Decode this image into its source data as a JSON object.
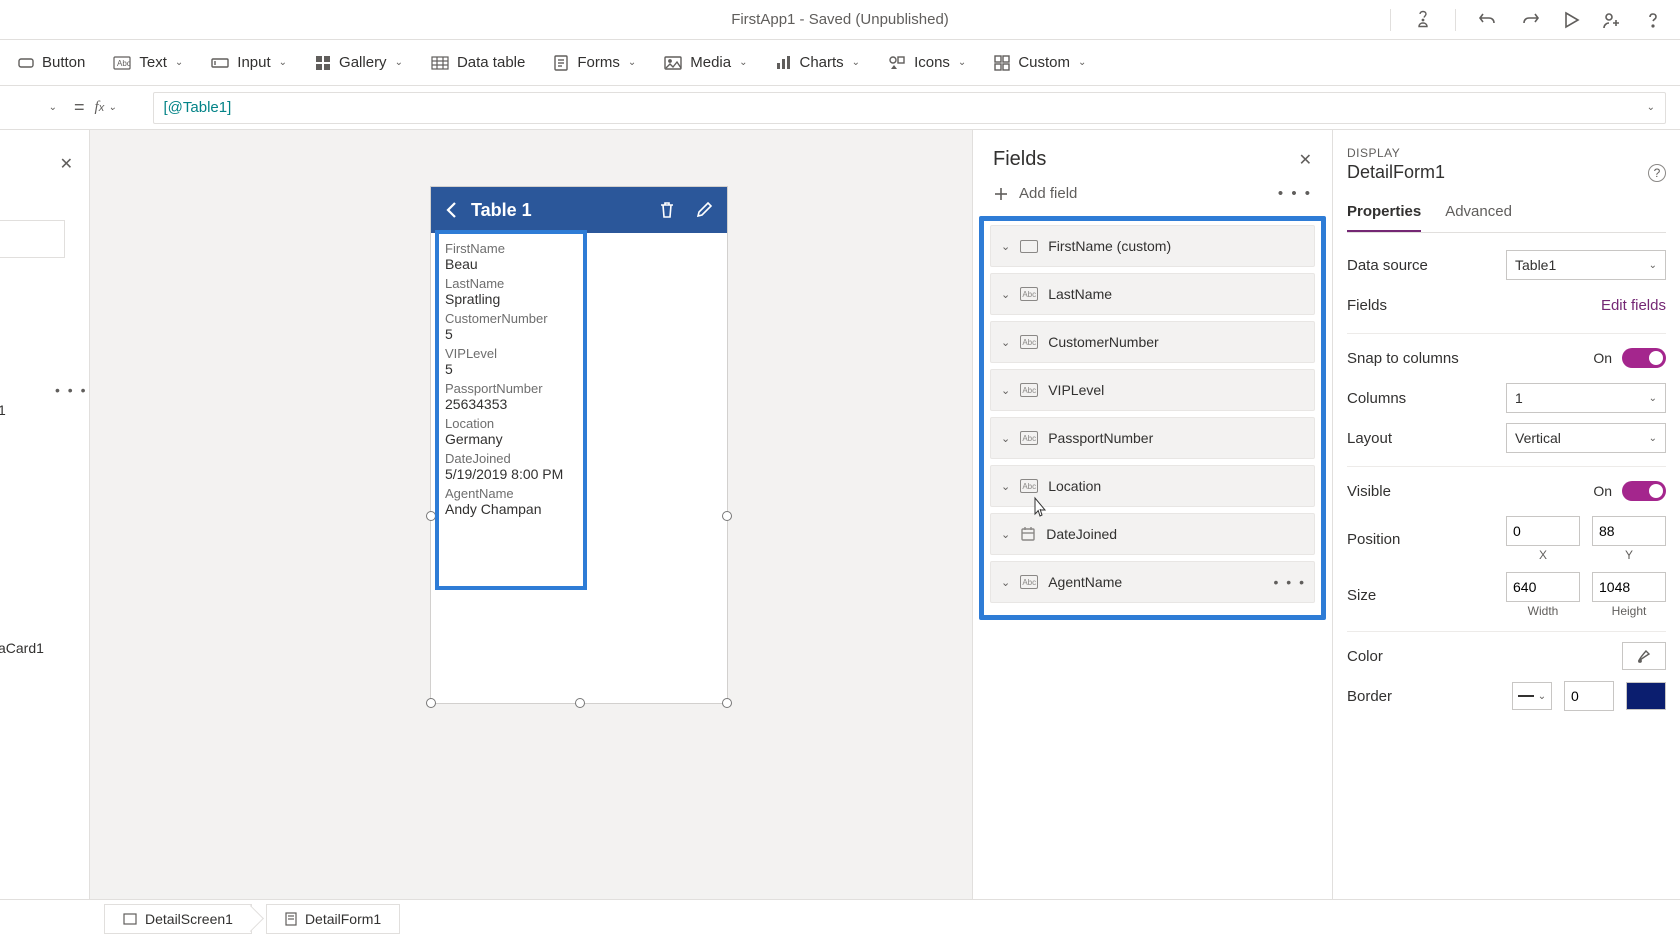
{
  "app_title": "FirstApp1 - Saved (Unpublished)",
  "ribbon": {
    "button": "Button",
    "text": "Text",
    "input": "Input",
    "gallery": "Gallery",
    "datatable": "Data table",
    "forms": "Forms",
    "media": "Media",
    "charts": "Charts",
    "icons": "Icons",
    "custom": "Custom"
  },
  "formula": {
    "value": "[@Table1]"
  },
  "left": {
    "label1": "1",
    "label2": "aCard1"
  },
  "phone": {
    "title": "Table 1",
    "record": [
      {
        "label": "FirstName",
        "value": "Beau"
      },
      {
        "label": "LastName",
        "value": "Spratling"
      },
      {
        "label": "CustomerNumber",
        "value": "5"
      },
      {
        "label": "VIPLevel",
        "value": "5"
      },
      {
        "label": "PassportNumber",
        "value": "25634353"
      },
      {
        "label": "Location",
        "value": "Germany"
      },
      {
        "label": "DateJoined",
        "value": "5/19/2019 8:00 PM"
      },
      {
        "label": "AgentName",
        "value": "Andy Champan"
      }
    ]
  },
  "fields_panel": {
    "title": "Fields",
    "add": "Add field",
    "items": [
      {
        "name": "FirstName (custom)",
        "icon": "card"
      },
      {
        "name": "LastName",
        "icon": "abc"
      },
      {
        "name": "CustomerNumber",
        "icon": "abc"
      },
      {
        "name": "VIPLevel",
        "icon": "abc"
      },
      {
        "name": "PassportNumber",
        "icon": "abc"
      },
      {
        "name": "Location",
        "icon": "abc"
      },
      {
        "name": "DateJoined",
        "icon": "date"
      },
      {
        "name": "AgentName",
        "icon": "abc"
      }
    ]
  },
  "props": {
    "section": "DISPLAY",
    "object": "DetailForm1",
    "tabs": {
      "properties": "Properties",
      "advanced": "Advanced"
    },
    "data_source_label": "Data source",
    "data_source_value": "Table1",
    "fields_label": "Fields",
    "edit_fields": "Edit fields",
    "snap_label": "Snap to columns",
    "snap_value": "On",
    "columns_label": "Columns",
    "columns_value": "1",
    "layout_label": "Layout",
    "layout_value": "Vertical",
    "visible_label": "Visible",
    "visible_value": "On",
    "position_label": "Position",
    "pos_x": "0",
    "pos_y": "88",
    "pos_x_sub": "X",
    "pos_y_sub": "Y",
    "size_label": "Size",
    "size_w": "640",
    "size_h": "1048",
    "size_w_sub": "Width",
    "size_h_sub": "Height",
    "color_label": "Color",
    "border_label": "Border",
    "border_width": "0"
  },
  "breadcrumb": {
    "screen": "DetailScreen1",
    "form": "DetailForm1"
  }
}
